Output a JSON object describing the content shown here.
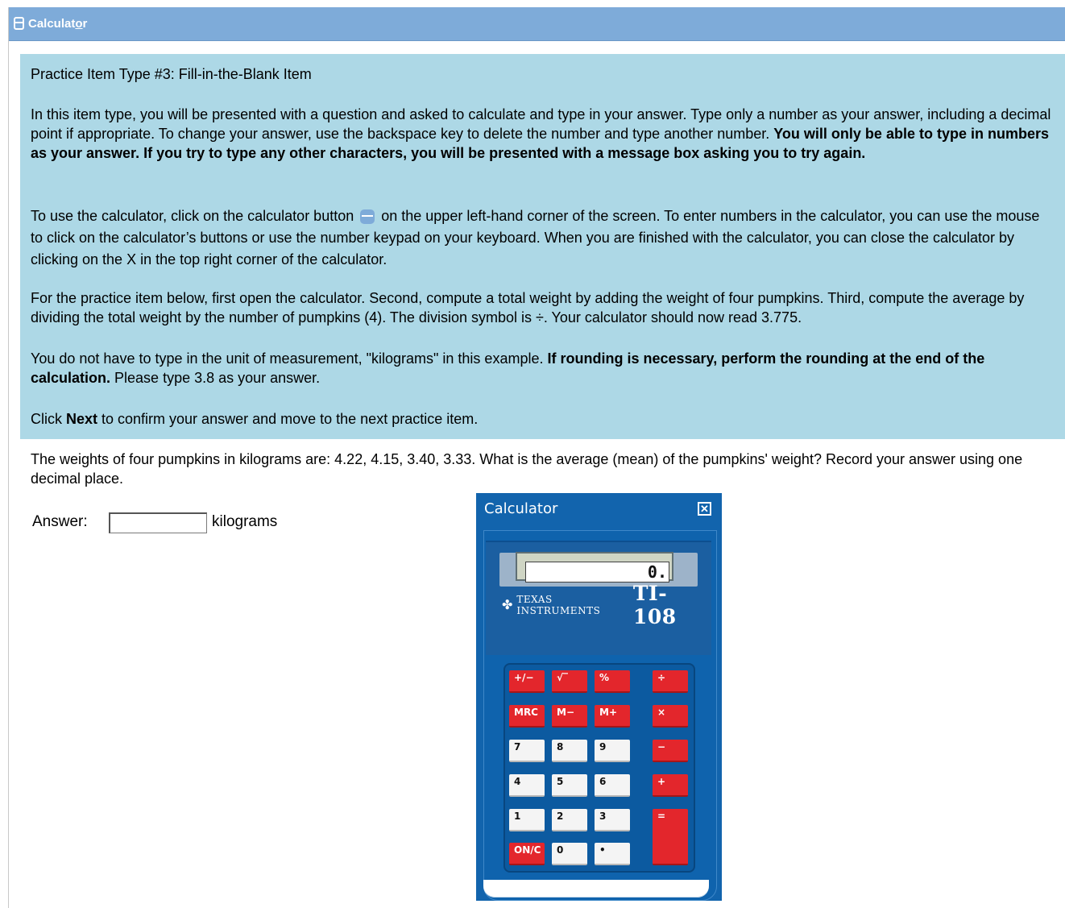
{
  "toolbar": {
    "calculator_label_prefix": "Calculat",
    "calculator_label_underlined": "o",
    "calculator_label_suffix": "r",
    "icon": "calculator-icon"
  },
  "instructions": {
    "heading": "Practice Item Type #3: Fill-in-the-Blank Item",
    "p1_plain": "In this item type, you will be presented with a question and asked to calculate and type in your answer. Type only a number as your answer, including a decimal point if appropriate. To change your answer, use the backspace key to delete the number and type another number. ",
    "p1_bold": "You will only be able to type in numbers as your answer. If you try to type any other characters, you will be presented with a message box asking you to try again.",
    "p2_before_icon": "To use the calculator, click on the calculator button ",
    "p2_after_icon": " on the upper left-hand corner of the screen. To enter numbers in the calculator, you can use the mouse to click on the calculator’s buttons or use the number keypad on your keyboard. When you are finished with the calculator, you can close the calculator by clicking on the X in the top right corner of the calculator.",
    "p3": "For the practice item below, first open the calculator. Second, compute a total weight by adding the weight of four pumpkins. Third, compute the average by dividing the total weight by the number of pumpkins (4). The division symbol is ÷. Your calculator should now read 3.775.",
    "p4_plain": "You do not have to type in the unit of measurement, \"kilograms\" in this example. ",
    "p4_bold": "If rounding is necessary, perform the rounding at the end of the calculation.",
    "p4_tail": " Please type 3.8 as your answer.",
    "p5_before": "Click ",
    "p5_bold": "Next",
    "p5_after": " to confirm your answer and move to the next practice item."
  },
  "question": {
    "text": "The weights of four pumpkins in kilograms are: 4.22, 4.15, 3.40, 3.33. What is the average (mean) of the pumpkins' weight? Record your answer using one decimal place.",
    "answer_label": "Answer:",
    "answer_value": "",
    "unit": "kilograms"
  },
  "calculator": {
    "title": "Calculator",
    "close_label": "✕",
    "display": "0.",
    "brand_logo": "✤",
    "brand_name": "TEXAS INSTRUMENTS",
    "model": "TI-108",
    "keys": {
      "plusminus": "+/−",
      "sqrt": "√‾",
      "percent": "%",
      "divide": "÷",
      "mrc": "MRC",
      "mminus": "M−",
      "mplus": "M+",
      "multiply": "×",
      "seven": "7",
      "eight": "8",
      "nine": "9",
      "minus": "−",
      "four": "4",
      "five": "5",
      "six": "6",
      "plus": "+",
      "one": "1",
      "two": "2",
      "three": "3",
      "equals": "=",
      "onc": "ON/C",
      "zero": "0",
      "decimal": "•"
    }
  }
}
